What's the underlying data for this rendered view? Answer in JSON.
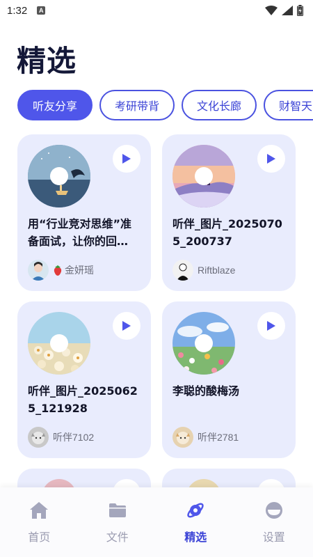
{
  "status": {
    "time": "1:32",
    "notif_letter": "A"
  },
  "page": {
    "title": "精选"
  },
  "tabs": [
    {
      "label": "听友分享",
      "active": true
    },
    {
      "label": "考研带背",
      "active": false
    },
    {
      "label": "文化长廊",
      "active": false
    },
    {
      "label": "财智天",
      "active": false
    }
  ],
  "cards": [
    {
      "title": "用“行业竞对思维”准备面试，让你的回…",
      "author": "金妍瑶",
      "author_prefix_icon": "strawberry-icon",
      "art": "night-sea-whale"
    },
    {
      "title": "听伴_图片_20250705_200737",
      "author": "Riftblaze",
      "art": "sunset-snow-hill"
    },
    {
      "title": "听伴_图片_20250625_121928",
      "author": "听伴7102",
      "art": "flower-field-sky"
    },
    {
      "title": "李聪的酸梅汤",
      "author": "听伴2781",
      "art": "meadow-flowers"
    }
  ],
  "nav": [
    {
      "label": "首页",
      "icon": "home-icon",
      "active": false
    },
    {
      "label": "文件",
      "icon": "folder-icon",
      "active": false
    },
    {
      "label": "精选",
      "icon": "planet-icon",
      "active": true
    },
    {
      "label": "设置",
      "icon": "settings-icon",
      "active": false
    }
  ],
  "colors": {
    "accent": "#4f56ea",
    "card_bg": "#e9ecfd",
    "title": "#141838"
  }
}
